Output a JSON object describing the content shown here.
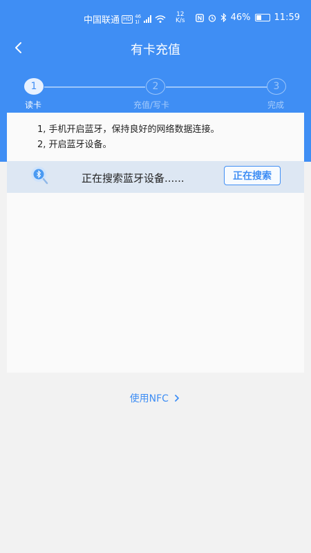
{
  "status_bar": {
    "carrier": "中国联通",
    "hd": "HD",
    "network_top": "46",
    "network_bottom": "1l",
    "speed_value": "12",
    "speed_unit": "K/s",
    "battery": "46%",
    "time": "11:59",
    "battery_level": 0.46
  },
  "header": {
    "title": "有卡充值",
    "back_icon": "chevron-left-icon"
  },
  "steps": [
    {
      "number": "1",
      "label": "读卡"
    },
    {
      "number": "2",
      "label": "充值/写卡"
    },
    {
      "number": "3",
      "label": "完成"
    }
  ],
  "instructions": [
    "1, 手机开启蓝牙，保持良好的网络数据连接。",
    "2, 开启蓝牙设备。"
  ],
  "search": {
    "status_text": "正在搜索蓝牙设备......",
    "button_label": "正在搜索",
    "icon": "bluetooth-search-icon"
  },
  "nfc_link": "使用NFC"
}
